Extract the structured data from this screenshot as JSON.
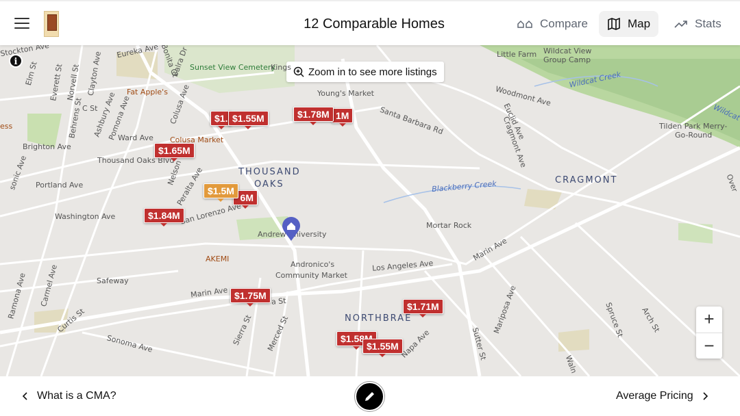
{
  "header": {
    "title": "12 Comparable Homes",
    "tabs": [
      {
        "label": "Compare",
        "icon": "houses-icon"
      },
      {
        "label": "Map",
        "icon": "map-icon",
        "active": true
      },
      {
        "label": "Stats",
        "icon": "trend-up-icon"
      }
    ]
  },
  "map": {
    "zoom_hint": "Zoom in to see more listings",
    "info": "i",
    "zoom_in": "+",
    "zoom_out": "−",
    "labels": {
      "stockton": "Stockton Ave",
      "eureka": "Eureka Ave",
      "bonita": "Bonita Ct",
      "balra": "Balra Dr",
      "cemetery": "Sunset View Cemetery",
      "kings": "Kings",
      "elm": "Elm St",
      "everett": "Everett St",
      "norvell": "Norvell St",
      "clayton": "Clayton Ave",
      "cst": "C St",
      "behrens": "Behrens St",
      "ashbury": "Ashbury Ave",
      "pomona": "Pomona Ave",
      "colusa_ave": "Colusa Ave",
      "fat_apples": "Fat Apple's",
      "brighton": "Brighton Ave",
      "ward": "Ward Ave",
      "colusa_market": "Colusa Market",
      "thousand_oaks_blvd": "Thousand Oaks Blvd",
      "nelson": "Nelson",
      "peralta": "Peralta Ave",
      "portland": "Portland Ave",
      "washington": "Washington Ave",
      "san_lorenzo": "San Lorenzo Ave",
      "sonic": "sonic Ave",
      "ess": "ess",
      "thousand": "THOUSAND",
      "oaks": "OAKS",
      "youngs": "Young's Market",
      "santa_barbara": "Santa Barbara Rd",
      "andrew": "Andrew University",
      "akemi": "AKEMI",
      "safeway": "Safeway",
      "andronicos1": "Andronico's",
      "andronicos2": "Community Market",
      "los_angeles": "Los Angeles Ave",
      "little_farm": "Little Farm",
      "wildcat_camp1": "Wildcat View",
      "wildcat_camp2": "Group Camp",
      "wildcat_creek": "Wildcat Creek",
      "woodmont": "Woodmont Ave",
      "euclid": "Euclid Ave",
      "cragmont_ave": "Cragmont Ave",
      "tilden1": "Tilden Park Merry-",
      "tilden2": "Go-Round",
      "wildcat2": "Wildcat",
      "cragmont": "CRAGMONT",
      "blackberry": "Blackberry Creek",
      "mortar": "Mortar Rock",
      "marin_e": "Marin Ave",
      "marin_w": "Marin Ave",
      "northbrae": "NORTHBRAE",
      "mariposa": "Mariposa Ave",
      "spruce": "Spruce St",
      "arch": "Arch St",
      "sutter": "Sutter St",
      "napa": "Napa Ave",
      "walnut": "Waln",
      "ramona": "Ramona Ave",
      "carmel": "Carmel Ave",
      "curtis": "Curtis St",
      "sonoma": "Sonoma Ave",
      "sierra": "Sierra St",
      "merced": "Merced St",
      "alameda": "a St",
      "overlook": "Over"
    },
    "markers": [
      "$1.",
      "$1.55M",
      "1M",
      "$1.78M",
      "$1.65M",
      "6M",
      "$1.5M",
      "$1.84M",
      "$1.75M",
      "$1.71M",
      "$1.58M",
      "$1.55M"
    ],
    "colors": {
      "listing": "#c0302f",
      "subject": "#e29a3c",
      "pin": "#5560c4"
    }
  },
  "footer": {
    "prev": "What is a CMA?",
    "next": "Average Pricing",
    "edit_icon": "pencil-icon"
  }
}
